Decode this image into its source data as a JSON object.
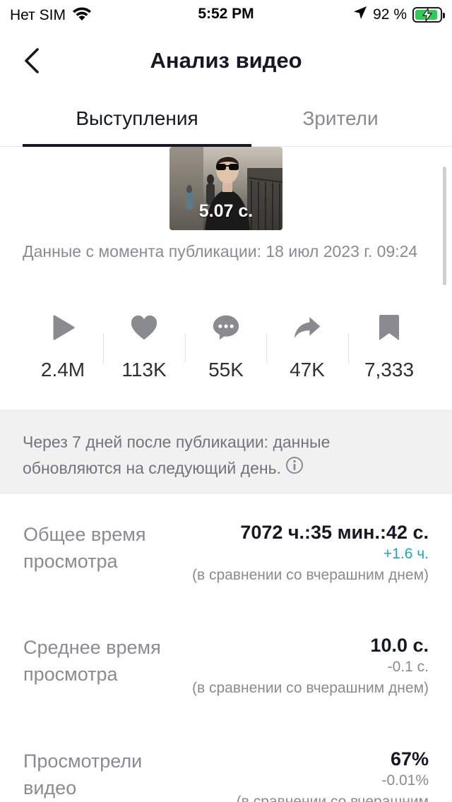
{
  "status_bar": {
    "carrier": "Нет SIM",
    "time": "5:52 PM",
    "battery_percent": "92 %",
    "battery_level": 0.92
  },
  "nav": {
    "title": "Анализ видео"
  },
  "tabs": [
    {
      "label": "Выступления",
      "active": true
    },
    {
      "label": "Зрители",
      "active": false
    }
  ],
  "video": {
    "duration": "5.07 с."
  },
  "published_text": "Данные с момента публикации: 18 июл 2023 г. 09:24",
  "stats": [
    {
      "icon": "play-icon",
      "value": "2.4M"
    },
    {
      "icon": "heart-icon",
      "value": "113K"
    },
    {
      "icon": "comment-icon",
      "value": "55K"
    },
    {
      "icon": "share-icon",
      "value": "47K"
    },
    {
      "icon": "bookmark-icon",
      "value": "7,333"
    }
  ],
  "info_text": "Через 7 дней после публикации: данные обновляются на следующий день.",
  "metrics": [
    {
      "label": "Общее время просмотра",
      "value": "7072 ч.:35 мин.:42 с.",
      "delta": "+1.6 ч.",
      "delta_color": "#20a4b8",
      "compare": "(в сравнении со вчерашним днем)"
    },
    {
      "label": "Среднее время просмотра",
      "value": "10.0 с.",
      "delta": "-0.1 с.",
      "delta_color": "#8a8b91",
      "compare": "(в сравнении со вчерашним днем)"
    },
    {
      "label": "Просмотрели видео",
      "value": "67%",
      "delta": "-0.01%",
      "delta_color": "#8a8b91",
      "compare": "(в сравнении со вчерашним"
    }
  ],
  "colors": {
    "positive_delta": "#20a4b8",
    "battery": "#34c759",
    "text_primary": "#161823",
    "text_secondary": "#8a8b91"
  }
}
